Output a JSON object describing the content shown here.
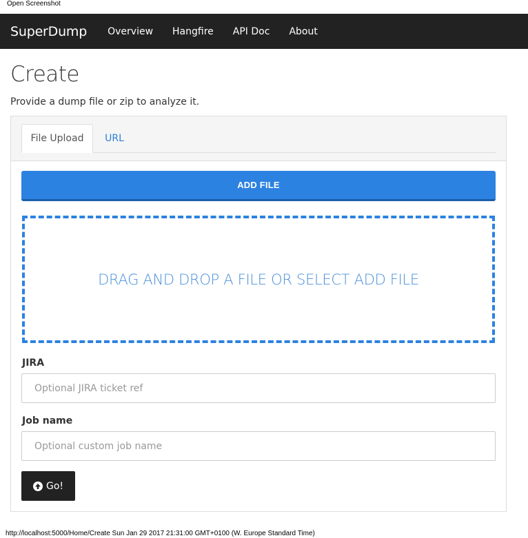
{
  "print_header": "Open Screenshot",
  "navbar": {
    "brand": "SuperDump",
    "links": [
      "Overview",
      "Hangfire",
      "API Doc",
      "About"
    ]
  },
  "page": {
    "title": "Create",
    "intro": "Provide a dump file or zip to analyze it."
  },
  "tabs": [
    {
      "label": "File Upload",
      "active": true
    },
    {
      "label": "URL",
      "active": false
    }
  ],
  "upload": {
    "add_file_label": "ADD FILE",
    "dropzone_text": "DRAG AND DROP A FILE OR SELECT ADD FILE"
  },
  "form": {
    "jira_label": "JIRA",
    "jira_placeholder": "Optional JIRA ticket ref",
    "jira_value": "",
    "jobname_label": "Job name",
    "jobname_placeholder": "Optional custom job name",
    "jobname_value": "",
    "submit_label": "Go!",
    "submit_icon": "circle-arrow-up-icon"
  },
  "print_footer": "http://localhost:5000/Home/Create Sun Jan 29 2017 21:31:00 GMT+0100 (W. Europe Standard Time)",
  "colors": {
    "navbar_bg": "#222222",
    "accent": "#2c82e0",
    "link": "#2c7fd8",
    "submit_bg": "#222222"
  }
}
